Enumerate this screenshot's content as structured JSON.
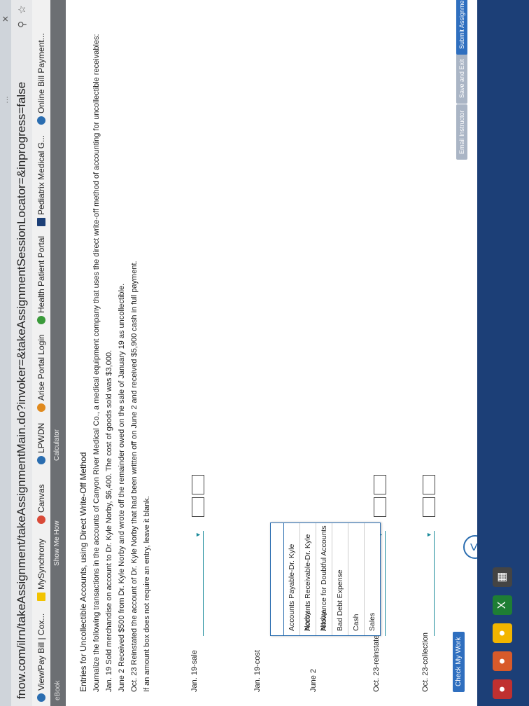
{
  "browser": {
    "tab_fragment": "…",
    "close_glyph": "✕",
    "url": "fnow.com/ilrn/takeAssignment/takeAssignmentMain.do?invoker=&takeAssignmentSessionLocator=&inprogress=false",
    "bookmarks": [
      "View/Pay Bill | Cox...",
      "MySynchrony",
      "Canvas",
      "LPWDN",
      "Arise Portal Login",
      "Health Patient Portal",
      "Pediatrix Medical G...",
      "Online Bill Payment..."
    ]
  },
  "toolbar": {
    "ebook": "eBook",
    "show_me_how": "Show Me How",
    "calculator": "Calculator"
  },
  "problem": {
    "title": "Entries for Uncollectible Accounts, using Direct Write-Off Method",
    "intro": "Journalize the following transactions in the accounts of Canyon River Medical Co., a medical equipment company that uses the direct write-off method of accounting for uncollectible receivables:",
    "t1": "Jan. 19  Sold merchandise on account to Dr. Kyle Norby, $6,400. The cost of goods sold was $3,000.",
    "t2": "June 2  Received $500 from Dr. Kyle Norby and wrote off the remainder owed on the sale of January 19 as uncollectible.",
    "t3": "Oct. 23  Reinstated the account of Dr. Kyle Norby that had been written off on June 2 and received $5,900 cash in full payment.",
    "note": "If an amount box does not require an entry, leave it blank."
  },
  "entries": {
    "jan19sale": "Jan. 19-sale",
    "jan19cost": "Jan. 19-cost",
    "june2": "June 2",
    "oct23reinstate": "Oct. 23-reinstate",
    "oct23collection": "Oct. 23-collection"
  },
  "dropdown": {
    "options": [
      "Accounts Payable-Dr. Kyle Norby",
      "Accounts Receivable-Dr. Kyle Norby",
      "Allowance for Doubtful Accounts",
      "Bad Debt Expense",
      "Cash",
      "Sales"
    ]
  },
  "footer": {
    "check": "Check My Work",
    "prev_glyph": "<",
    "email": "Email Instructor",
    "save": "Save and Exit",
    "submit": "Submit Assignment for"
  }
}
